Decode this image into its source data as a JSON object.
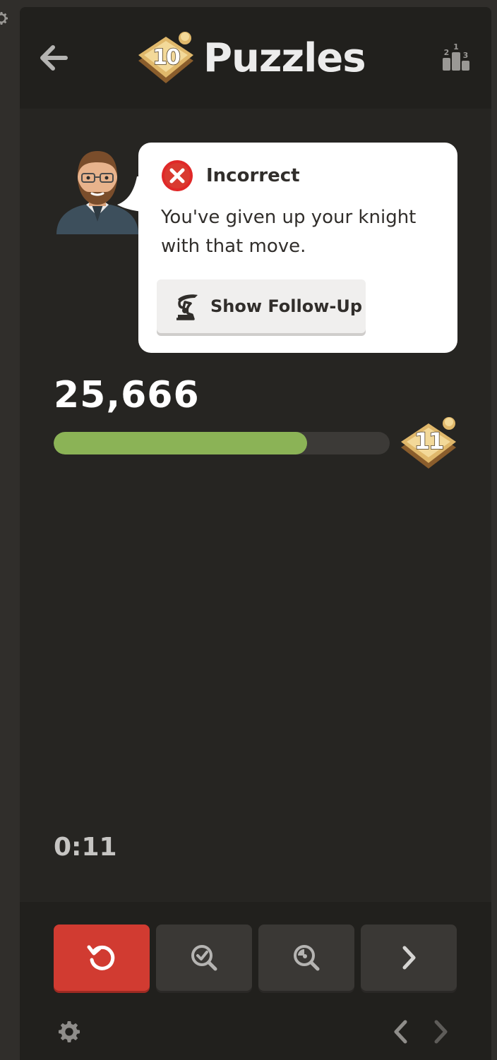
{
  "header": {
    "title": "Puzzles",
    "level_badge": "10",
    "back_icon": "arrow-left-icon",
    "leaderboard_icon": "leaderboard-podium-icon",
    "leaderboard_digits": [
      "2",
      "1",
      "3"
    ]
  },
  "feedback": {
    "status": "Incorrect",
    "status_icon": "x-circle-icon",
    "message": "You've given up your knight with that move.",
    "followup_label": "Show Follow-Up",
    "followup_icon": "knight-arrow-icon"
  },
  "progress": {
    "score": "25,666",
    "fraction": 0.755,
    "next_level_badge": "11"
  },
  "timer": "0:11",
  "controls": {
    "retry_icon": "retry-icon",
    "hint_icon": "magnify-check-icon",
    "solution_icon": "magnify-key-icon",
    "next_icon": "chevron-right-icon"
  },
  "footer": {
    "settings_icon": "gear-icon",
    "prev_icon": "chevron-left-icon",
    "next_icon": "chevron-right-icon"
  },
  "colors": {
    "accent_green": "#8bb356",
    "retry_red": "#d13b31",
    "panel_bg": "#262522",
    "header_bg": "#21201d"
  }
}
